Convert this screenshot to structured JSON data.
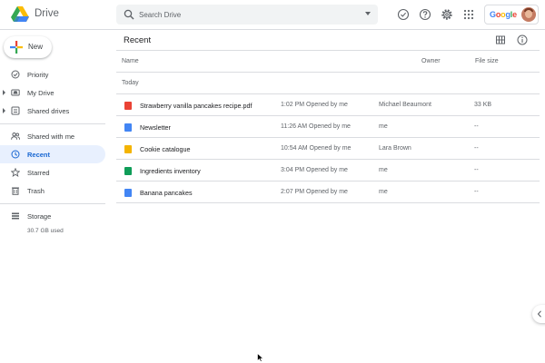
{
  "header": {
    "app_name": "Drive",
    "search_placeholder": "Search Drive",
    "account_brand": "Google",
    "icons": [
      "drive-logo-icon",
      "search-icon",
      "offline-icon",
      "help-icon",
      "settings-icon",
      "apps-grid-icon"
    ]
  },
  "sidebar": {
    "new_label": "New",
    "items": [
      {
        "label": "Priority",
        "icon": "priority-icon",
        "has_caret": false,
        "active": false
      },
      {
        "label": "My Drive",
        "icon": "my-drive-icon",
        "has_caret": true,
        "active": false
      },
      {
        "label": "Shared drives",
        "icon": "shared-drives-icon",
        "has_caret": true,
        "active": false
      },
      {
        "label": "Shared with me",
        "icon": "shared-with-me-icon",
        "has_caret": false,
        "active": false
      },
      {
        "label": "Recent",
        "icon": "clock-icon",
        "has_caret": false,
        "active": true
      },
      {
        "label": "Starred",
        "icon": "star-icon",
        "has_caret": false,
        "active": false
      },
      {
        "label": "Trash",
        "icon": "trash-icon",
        "has_caret": false,
        "active": false
      },
      {
        "label": "Storage",
        "icon": "storage-icon",
        "has_caret": false,
        "active": false
      }
    ],
    "storage_used": "30.7 GB used"
  },
  "main": {
    "title": "Recent",
    "columns": {
      "name": "Name",
      "owner": "Owner",
      "size": "File size"
    },
    "section_label": "Today",
    "files": [
      {
        "name": "Strawberry vanilla pancakes recipe.pdf",
        "date": "1:02 PM Opened by me",
        "owner": "Michael Beaumont",
        "size": "33 KB",
        "type": "pdf",
        "color": "#ea4335"
      },
      {
        "name": "Newsletter",
        "date": "11:26 AM Opened by me",
        "owner": "me",
        "size": "--",
        "type": "docs",
        "color": "#4285f4"
      },
      {
        "name": "Cookie catalogue",
        "date": "10:54 AM Opened by me",
        "owner": "Lara Brown",
        "size": "--",
        "type": "slides",
        "color": "#f4b400"
      },
      {
        "name": "Ingredients inventory",
        "date": "3:04 PM Opened by me",
        "owner": "me",
        "size": "--",
        "type": "sheets",
        "color": "#0f9d58"
      },
      {
        "name": "Banana pancakes",
        "date": "2:07 PM Opened by me",
        "owner": "me",
        "size": "--",
        "type": "docs",
        "color": "#4285f4"
      }
    ]
  },
  "colors": {
    "accent": "#1967d2",
    "active_bg": "#e8f0fe",
    "divider": "#dadce0",
    "google_blue": "#4285f4",
    "google_red": "#ea4335",
    "google_yellow": "#fbbc05",
    "google_green": "#34a853"
  }
}
